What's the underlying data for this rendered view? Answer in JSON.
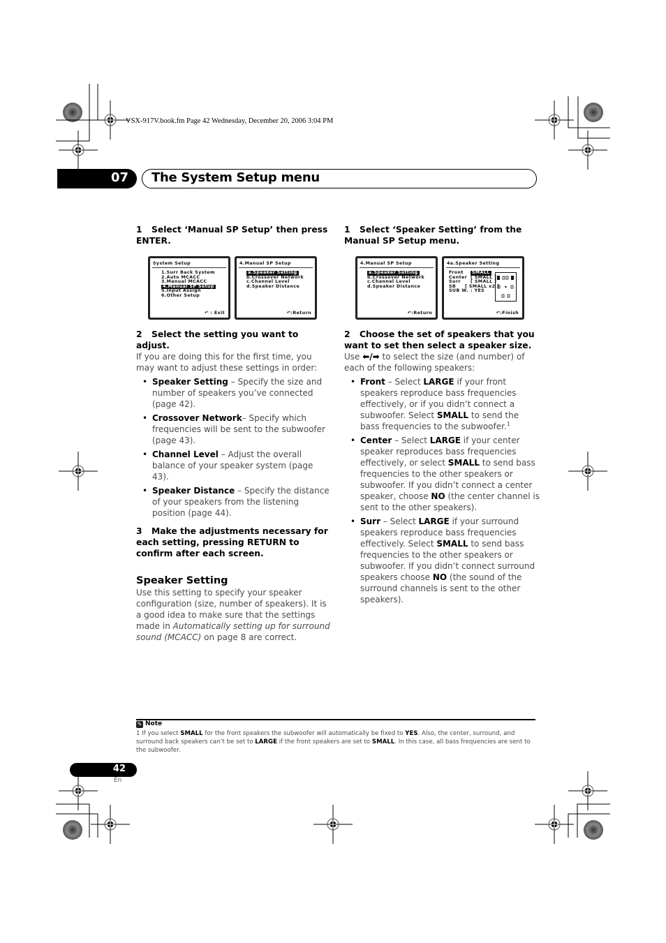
{
  "slug": "VSX-917V.book.fm  Page 42  Wednesday, December 20, 2006  3:04 PM",
  "chapter": {
    "number": "07",
    "title": "The System Setup menu"
  },
  "left_column": {
    "step1": {
      "num": "1",
      "text": "Select ‘Manual SP Setup’ then press ENTER."
    },
    "screen_system_setup": {
      "title": "System  Setup",
      "items": [
        "1.Surr  Back  System",
        "2.Auto  MCACC",
        "3.Manual  MCACC",
        "4.Manual  SP  Setup",
        "5.Input  Assign",
        "6.Other  Setup"
      ],
      "selected_index": 3,
      "footer": "↶ : Exit"
    },
    "screen_manual_sp": {
      "title": "4.Manual  SP  Setup",
      "items": [
        "a.Speaker  Setting",
        "b.Crossover  Network",
        "c.Channel  Level",
        "d.Speaker  Distance"
      ],
      "selected_index": 0,
      "footer": "↶:Return"
    },
    "step2": {
      "num": "2",
      "text": "Select the setting you want to adjust.",
      "intro": "If you are doing this for the first time, you may want to adjust these settings in order:",
      "bullets": [
        {
          "term": "Speaker Setting",
          "desc": " – Specify the size and number of speakers you’ve connected (page 42)."
        },
        {
          "term": "Crossover Network",
          "desc": "– Specify which frequencies will be sent to the subwoofer (page 43)."
        },
        {
          "term": "Channel Level",
          "desc": " – Adjust the overall balance of your speaker system (page 43)."
        },
        {
          "term": "Speaker Distance",
          "desc": " – Specify the distance of your speakers from the listening position (page 44)."
        }
      ]
    },
    "step3": {
      "num": "3",
      "text": "Make the adjustments necessary for each setting, pressing RETURN to confirm after each screen."
    },
    "section": {
      "heading": "Speaker Setting",
      "body_start": "Use this setting to specify your speaker configuration (size, number of speakers). It is a good idea to make sure that the settings made in ",
      "body_italic": "Automatically setting up for surround sound (MCACC)",
      "body_end": " on page 8 are correct."
    }
  },
  "right_column": {
    "step1": {
      "num": "1",
      "text": "Select ‘Speaker Setting’ from the Manual SP Setup menu."
    },
    "screen_manual_sp": {
      "title": "4.Manual  SP  Setup",
      "items": [
        "a.Speaker  Setting",
        "b.Crossover  Network",
        "c.Channel  Level",
        "d.Speaker  Distance"
      ],
      "selected_index": 0,
      "footer": "↶:Return"
    },
    "screen_speaker_setting": {
      "title": "4a.Speaker  Setting",
      "rows": [
        {
          "label": "Front",
          "value": "SMALL"
        },
        {
          "label": "Center",
          "value": "[  SMALL ]"
        },
        {
          "label": "Surr",
          "value": "[  SMALL ]"
        },
        {
          "label": "SB",
          "value": "[ SMALL x2 ]"
        },
        {
          "label": "SUB W.",
          "value": ":    YES"
        }
      ],
      "footer": "↶:Finish"
    },
    "step2": {
      "num": "2",
      "text": "Choose the set of speakers that you want to set then select a speaker size.",
      "intro_a": "Use ",
      "intro_arrows": "⬅/➡",
      "intro_b": " to select the size (and number) of each of the following speakers:",
      "bullets": [
        {
          "parts": [
            {
              "b": "Front"
            },
            {
              "t": " – Select "
            },
            {
              "b": "LARGE"
            },
            {
              "t": " if your front speakers reproduce bass frequencies effectively, or if you didn’t connect a subwoofer. Select "
            },
            {
              "b": "SMALL"
            },
            {
              "t": " to send the bass frequencies to the subwoofer."
            },
            {
              "sup": "1"
            }
          ]
        },
        {
          "parts": [
            {
              "b": "Center"
            },
            {
              "t": " – Select "
            },
            {
              "b": "LARGE"
            },
            {
              "t": " if your center speaker reproduces bass frequencies effectively, or select "
            },
            {
              "b": "SMALL"
            },
            {
              "t": " to send bass frequencies to the other speakers or subwoofer. If you didn’t connect a center speaker, choose "
            },
            {
              "b": "NO"
            },
            {
              "t": " (the center channel is sent to the other speakers)."
            }
          ]
        },
        {
          "parts": [
            {
              "b": "Surr"
            },
            {
              "t": " – Select "
            },
            {
              "b": "LARGE"
            },
            {
              "t": " if your surround speakers reproduce bass frequencies effectively. Select "
            },
            {
              "b": "SMALL"
            },
            {
              "t": " to send bass frequencies to the other speakers or subwoofer. If you didn’t connect surround speakers choose "
            },
            {
              "b": "NO"
            },
            {
              "t": " (the sound of the surround channels is sent to the other speakers)."
            }
          ]
        }
      ]
    }
  },
  "note": {
    "heading": "Note",
    "parts": [
      {
        "t": "1 If you select "
      },
      {
        "b": "SMALL"
      },
      {
        "t": " for the front speakers the subwoofer will automatically be fixed to "
      },
      {
        "b": "YES"
      },
      {
        "t": ". Also, the center, surround, and surround back speakers can’t be set to "
      },
      {
        "b": "LARGE"
      },
      {
        "t": " if the front speakers are set to "
      },
      {
        "b": "SMALL"
      },
      {
        "t": ". In this case, all bass frequencies are sent to the subwoofer."
      }
    ]
  },
  "footer": {
    "page_number": "42",
    "language": "En"
  }
}
